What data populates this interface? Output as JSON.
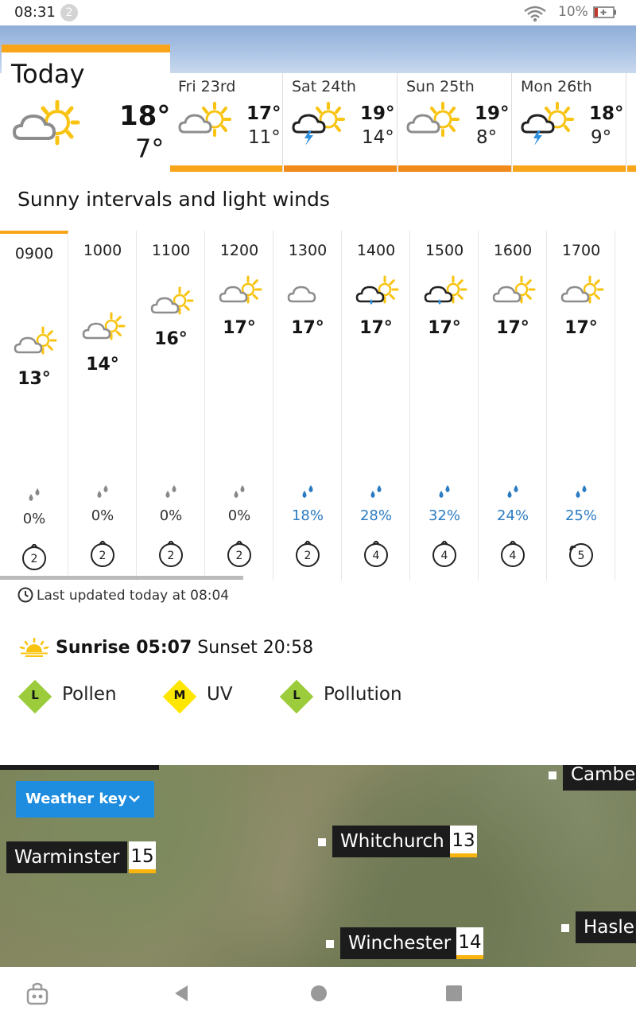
{
  "status": {
    "time": "08:31",
    "notifications": "2",
    "battery": "10%"
  },
  "today": {
    "label": "Today",
    "max": "18°",
    "min": "7°",
    "icon": "sunny-intervals-icon"
  },
  "days": [
    {
      "name": "Fri 23rd",
      "max": "17°",
      "min": "11°",
      "icon": "sunny-intervals-icon",
      "bar": "#f9a51a"
    },
    {
      "name": "Sat 24th",
      "max": "19°",
      "min": "14°",
      "icon": "thunder-sun-icon",
      "bar": "#f08a1a"
    },
    {
      "name": "Sun 25th",
      "max": "19°",
      "min": "8°",
      "icon": "sunny-intervals-icon",
      "bar": "#f08a1a"
    },
    {
      "name": "Mon 26th",
      "max": "18°",
      "min": "9°",
      "icon": "thunder-sun-icon",
      "bar": "#f9a51a"
    }
  ],
  "summary": "Sunny intervals and light winds",
  "hours": [
    {
      "time": "0900",
      "temp": "13°",
      "icon": "sunny-intervals",
      "rain": "0%",
      "wind": "2",
      "wet": false
    },
    {
      "time": "1000",
      "temp": "14°",
      "icon": "sunny-intervals",
      "rain": "0%",
      "wind": "2",
      "wet": false
    },
    {
      "time": "1100",
      "temp": "16°",
      "icon": "sunny-intervals",
      "rain": "0%",
      "wind": "2",
      "wet": false
    },
    {
      "time": "1200",
      "temp": "17°",
      "icon": "sunny-intervals",
      "rain": "0%",
      "wind": "2",
      "wet": false
    },
    {
      "time": "1300",
      "temp": "17°",
      "icon": "cloud",
      "rain": "18%",
      "wind": "2",
      "wet": true
    },
    {
      "time": "1400",
      "temp": "17°",
      "icon": "rain-sun",
      "rain": "28%",
      "wind": "4",
      "wet": true
    },
    {
      "time": "1500",
      "temp": "17°",
      "icon": "rain-sun",
      "rain": "32%",
      "wind": "4",
      "wet": true
    },
    {
      "time": "1600",
      "temp": "17°",
      "icon": "sunny-intervals",
      "rain": "24%",
      "wind": "4",
      "wet": true
    },
    {
      "time": "1700",
      "temp": "17°",
      "icon": "sunny-intervals",
      "rain": "25%",
      "wind": "5",
      "wet": true
    }
  ],
  "updated": "Last updated today at 08:04",
  "sun": {
    "sunrise_label": "Sunrise 05:07",
    "sunset_label": "Sunset 20:58"
  },
  "indicators": [
    {
      "letter": "L",
      "label": "Pollen",
      "color": "#9ccc3c"
    },
    {
      "letter": "M",
      "label": "UV",
      "color": "#ffe600"
    },
    {
      "letter": "L",
      "label": "Pollution",
      "color": "#9ccc3c"
    }
  ],
  "map": {
    "weather_key": "Weather key",
    "towns": [
      {
        "name": "Warminster",
        "temp": "15"
      },
      {
        "name": "Whitchurch",
        "temp": "13"
      },
      {
        "name": "Winchester",
        "temp": "14"
      },
      {
        "name": "Camber",
        "temp": ""
      },
      {
        "name": "Hasler",
        "temp": ""
      }
    ]
  },
  "colors": {
    "accent": "#f9a51a",
    "rain_blue": "#2b7bc2",
    "sun": "#f9c311"
  }
}
